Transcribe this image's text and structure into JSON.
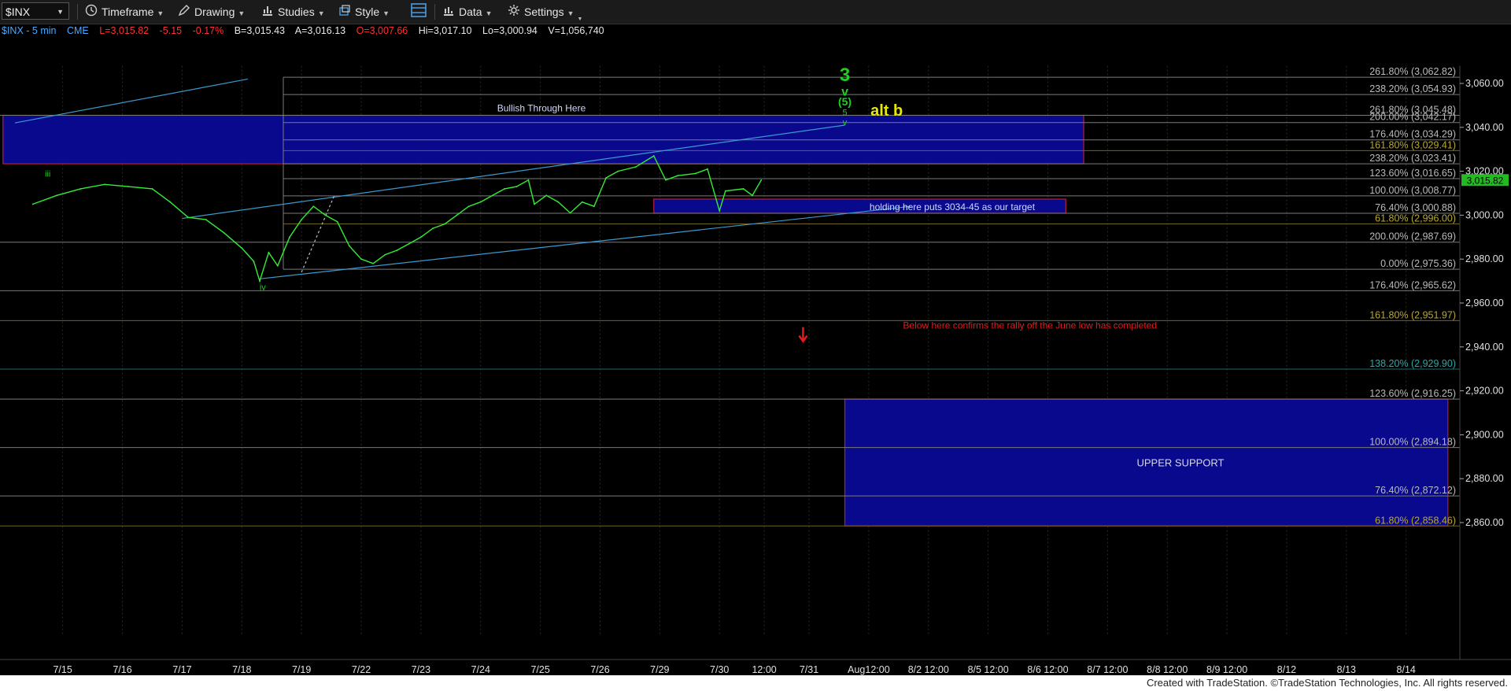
{
  "toolbar": {
    "symbol": "$INX",
    "items": [
      {
        "label": "Timeframe",
        "icon": "clock-icon"
      },
      {
        "label": "Drawing",
        "icon": "pen-icon"
      },
      {
        "label": "Studies",
        "icon": "studies-icon"
      },
      {
        "label": "Style",
        "icon": "style-icon"
      },
      {
        "label": "",
        "icon": "layout-icon"
      },
      {
        "label": "Data",
        "icon": "data-icon"
      },
      {
        "label": "Settings",
        "icon": "gear-icon"
      }
    ]
  },
  "quote": {
    "symbol": "$INX - 5 min",
    "exchange": "CME",
    "last": "L=3,015.82",
    "change": "-5.15",
    "pct": "-0.17%",
    "bid": "B=3,015.43",
    "ask": "A=3,016.13",
    "open": "O=3,007.66",
    "high": "Hi=3,017.10",
    "low": "Lo=3,000.94",
    "volume": "V=1,056,740"
  },
  "colors": {
    "background": "#000000",
    "price": "#33ee33",
    "blue_zone": "#0a0a96",
    "zone_border": "#c02040",
    "label_red": "#e01c1c",
    "alt_b": "#e8e800",
    "count_green": "#22cc22",
    "last_price_box": "#22bb22"
  },
  "credits": "Created with TradeStation. ©TradeStation Technologies, Inc. All rights reserved.",
  "chart_data": {
    "type": "line",
    "title": "$INX - 5 min",
    "ylim": [
      2824,
      3068
    ],
    "y_ticks": [
      2860,
      2880,
      2900,
      2920,
      2940,
      2960,
      2980,
      3000,
      3020,
      3040,
      3060
    ],
    "y_tick_labels": [
      "2,860.00",
      "2,880.00",
      "2,900.00",
      "2,920.00",
      "2,940.00",
      "2,960.00",
      "2,980.00",
      "3,000.00",
      "3,020.00",
      "3,040.00",
      "3,060.00"
    ],
    "last_price": 3015.82,
    "last_price_label": "3,015.82",
    "x_tick_labels": [
      "7/15",
      "7/16",
      "7/17",
      "7/18",
      "7/19",
      "7/22",
      "7/23",
      "7/24",
      "7/25",
      "7/26",
      "7/29",
      "7/30",
      "12:00",
      "7/31",
      "Aug12:00",
      "8/2 12:00",
      "8/5 12:00",
      "8/6 12:00",
      "8/7 12:00",
      "8/8 12:00",
      "8/9 12:00",
      "8/12",
      "8/13",
      "8/14"
    ],
    "x_tick_index": [
      0.5,
      1.5,
      2.5,
      3.5,
      4.5,
      5.5,
      6.5,
      7.5,
      8.5,
      9.5,
      10.5,
      11.5,
      12.25,
      13,
      14,
      15,
      16,
      17,
      18,
      19,
      20,
      21,
      22,
      23
    ],
    "price_series": [
      {
        "t": 0.0,
        "v": 3005.0
      },
      {
        "t": 0.4,
        "v": 3009.0
      },
      {
        "t": 0.8,
        "v": 3012.0
      },
      {
        "t": 1.2,
        "v": 3014.0
      },
      {
        "t": 1.6,
        "v": 3013.0
      },
      {
        "t": 2.0,
        "v": 3012.0
      },
      {
        "t": 2.3,
        "v": 3006.0
      },
      {
        "t": 2.6,
        "v": 2999.0
      },
      {
        "t": 2.9,
        "v": 2998.0
      },
      {
        "t": 3.2,
        "v": 2992.0
      },
      {
        "t": 3.5,
        "v": 2985.0
      },
      {
        "t": 3.7,
        "v": 2979.0
      },
      {
        "t": 3.8,
        "v": 2970.0
      },
      {
        "t": 3.95,
        "v": 2983.0
      },
      {
        "t": 4.1,
        "v": 2977.0
      },
      {
        "t": 4.3,
        "v": 2990.0
      },
      {
        "t": 4.5,
        "v": 2998.0
      },
      {
        "t": 4.7,
        "v": 3004.0
      },
      {
        "t": 4.9,
        "v": 3000.0
      },
      {
        "t": 5.1,
        "v": 2997.0
      },
      {
        "t": 5.3,
        "v": 2986.0
      },
      {
        "t": 5.5,
        "v": 2980.0
      },
      {
        "t": 5.7,
        "v": 2978.0
      },
      {
        "t": 5.9,
        "v": 2982.0
      },
      {
        "t": 6.1,
        "v": 2984.0
      },
      {
        "t": 6.3,
        "v": 2987.0
      },
      {
        "t": 6.5,
        "v": 2990.0
      },
      {
        "t": 6.7,
        "v": 2994.0
      },
      {
        "t": 6.9,
        "v": 2996.0
      },
      {
        "t": 7.1,
        "v": 3000.0
      },
      {
        "t": 7.3,
        "v": 3004.0
      },
      {
        "t": 7.5,
        "v": 3006.0
      },
      {
        "t": 7.7,
        "v": 3009.0
      },
      {
        "t": 7.9,
        "v": 3012.0
      },
      {
        "t": 8.1,
        "v": 3013.0
      },
      {
        "t": 8.3,
        "v": 3016.0
      },
      {
        "t": 8.4,
        "v": 3005.0
      },
      {
        "t": 8.6,
        "v": 3009.0
      },
      {
        "t": 8.8,
        "v": 3006.0
      },
      {
        "t": 9.0,
        "v": 3001.0
      },
      {
        "t": 9.2,
        "v": 3006.0
      },
      {
        "t": 9.4,
        "v": 3004.0
      },
      {
        "t": 9.6,
        "v": 3017.0
      },
      {
        "t": 9.8,
        "v": 3020.0
      },
      {
        "t": 10.1,
        "v": 3022.0
      },
      {
        "t": 10.4,
        "v": 3027.0
      },
      {
        "t": 10.6,
        "v": 3016.0
      },
      {
        "t": 10.8,
        "v": 3018.0
      },
      {
        "t": 11.1,
        "v": 3019.0
      },
      {
        "t": 11.3,
        "v": 3021.0
      },
      {
        "t": 11.5,
        "v": 3002.0
      },
      {
        "t": 11.6,
        "v": 3011.0
      },
      {
        "t": 11.9,
        "v": 3012.0
      },
      {
        "t": 12.05,
        "v": 3009.0
      },
      {
        "t": 12.2,
        "v": 3016.0
      }
    ],
    "fib_levels": [
      {
        "pct": "261.80%",
        "value": 3062.82,
        "label": "261.80% (3,062.82)",
        "color": "#bbbbbb"
      },
      {
        "pct": "238.20%",
        "value": 3054.93,
        "label": "238.20% (3,054.93)",
        "color": "#bbbbbb"
      },
      {
        "pct": "261.80%",
        "value": 3045.48,
        "label": "261.80% (3,045.48)",
        "color": "#bbbbbb"
      },
      {
        "pct": "200.00%",
        "value": 3042.17,
        "label": "200.00% (3,042.17)",
        "color": "#bbbbbb"
      },
      {
        "pct": "176.40%",
        "value": 3034.29,
        "label": "176.40% (3,034.29)",
        "color": "#bbbbbb"
      },
      {
        "pct": "161.80%",
        "value": 3029.41,
        "label": "161.80% (3,029.41)",
        "color": "#b8a830"
      },
      {
        "pct": "238.20%",
        "value": 3023.41,
        "label": "238.20% (3,023.41)",
        "color": "#bbbbbb"
      },
      {
        "pct": "123.60%",
        "value": 3016.65,
        "label": "123.60% (3,016.65)",
        "color": "#bbbbbb"
      },
      {
        "pct": "100.00%",
        "value": 3008.77,
        "label": "100.00% (3,008.77)",
        "color": "#bbbbbb"
      },
      {
        "pct": "76.40%",
        "value": 3000.88,
        "label": "76.40% (3,000.88)",
        "color": "#bbbbbb"
      },
      {
        "pct": "61.80%",
        "value": 2996.0,
        "label": "61.80% (2,996.00)",
        "color": "#b8a830"
      },
      {
        "pct": "200.00%",
        "value": 2987.69,
        "label": "200.00% (2,987.69)",
        "color": "#bbbbbb"
      },
      {
        "pct": "0.00%",
        "value": 2975.36,
        "label": "0.00% (2,975.36)",
        "color": "#bbbbbb"
      },
      {
        "pct": "176.40%",
        "value": 2965.62,
        "label": "176.40% (2,965.62)",
        "color": "#bbbbbb"
      },
      {
        "pct": "161.80%",
        "value": 2951.97,
        "label": "161.80% (2,951.97)",
        "color": "#b8a830"
      },
      {
        "pct": "138.20%",
        "value": 2929.9,
        "label": "138.20% (2,929.90)",
        "color": "#2aa8a8"
      },
      {
        "pct": "123.60%",
        "value": 2916.25,
        "label": "123.60% (2,916.25)",
        "color": "#bbbbbb"
      },
      {
        "pct": "100.00%",
        "value": 2894.18,
        "label": "100.00% (2,894.18)",
        "color": "#bbbbbb"
      },
      {
        "pct": "76.40%",
        "value": 2872.12,
        "label": "76.40% (2,872.12)",
        "color": "#bbbbbb"
      },
      {
        "pct": "61.80%",
        "value": 2858.46,
        "label": "61.80% (2,858.46)",
        "color": "#b8a830"
      }
    ],
    "zones": [
      {
        "name": "bullish-zone",
        "t0": -0.5,
        "t1": 17.6,
        "v0": 3023.41,
        "v1": 3045.48,
        "label": "Bullish Through Here"
      },
      {
        "name": "holding-zone",
        "t0": 10.4,
        "t1": 17.3,
        "v0": 3000.88,
        "v1": 3007.3,
        "label": "holding here puts 3034-45 as our target"
      },
      {
        "name": "upper-support-zone",
        "t0": 13.6,
        "t1": 23.7,
        "v0": 2858.46,
        "v1": 2916.25,
        "label": "UPPER SUPPORT"
      }
    ],
    "annotations": [
      {
        "text": "iii",
        "t": 0.25,
        "v": 3017.5,
        "color": "#22cc22",
        "size": 11
      },
      {
        "text": "iv",
        "t": 3.85,
        "v": 2966.0,
        "color": "#22cc22",
        "size": 11
      },
      {
        "text": "3",
        "t": 13.6,
        "v": 3061.0,
        "color": "#22cc22",
        "size": 24,
        "bold": true
      },
      {
        "text": "v",
        "t": 13.6,
        "v": 3054.5,
        "color": "#22cc22",
        "size": 16,
        "bold": true
      },
      {
        "text": "(5)",
        "t": 13.6,
        "v": 3050.0,
        "color": "#22cc22",
        "size": 14,
        "bold": true
      },
      {
        "text": "5",
        "t": 13.6,
        "v": 3045.5,
        "color": "#22cc22",
        "size": 11
      },
      {
        "text": "v",
        "t": 13.6,
        "v": 3041.0,
        "color": "#22cc22",
        "size": 11
      },
      {
        "text": "alt b",
        "t": 14.3,
        "v": 3045.3,
        "color": "#e8e800",
        "size": 20,
        "bold": true
      },
      {
        "text": "Below here confirms the rally off the June low has completed",
        "t": 16.7,
        "v": 2948.3,
        "color": "#e01c1c",
        "size": 12
      }
    ],
    "trendlines": [
      {
        "t0": -0.3,
        "v0": 3042.0,
        "t1": 3.6,
        "v1": 3062.0,
        "color": "#3a9ad0",
        "dash": false
      },
      {
        "t0": 2.5,
        "v0": 2998.5,
        "t1": 13.6,
        "v1": 3041.0,
        "color": "#3a9ad0",
        "dash": false
      },
      {
        "t0": 3.8,
        "v0": 2971.0,
        "t1": 14.7,
        "v1": 3004.0,
        "color": "#3a9ad0",
        "dash": false
      },
      {
        "t0": 4.5,
        "v0": 2974.0,
        "t1": 5.05,
        "v1": 3009.0,
        "color": "#bbbbbb",
        "dash": true
      }
    ],
    "markers": [
      {
        "type": "down-arrow",
        "t": 12.9,
        "v": 2944.0,
        "color": "#e01c1c"
      }
    ]
  }
}
